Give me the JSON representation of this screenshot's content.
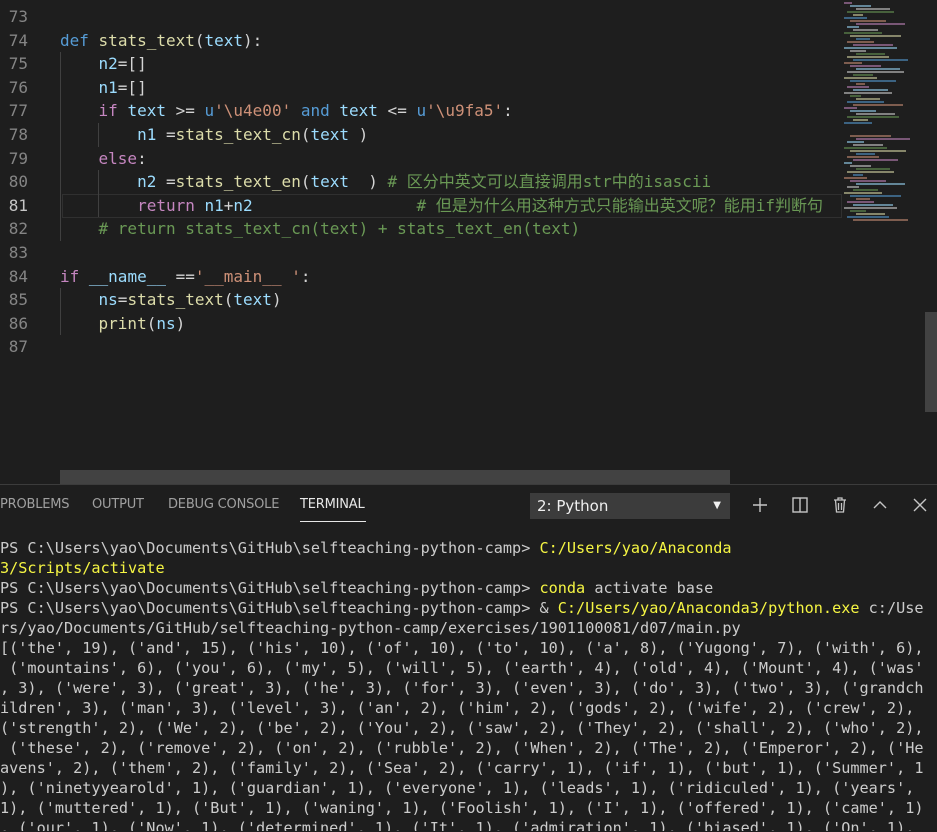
{
  "editor": {
    "lines": [
      {
        "num": "73",
        "tokens": []
      },
      {
        "num": "74",
        "tokens": [
          {
            "t": "def",
            "c": "kw"
          },
          {
            "t": " ",
            "c": "op"
          },
          {
            "t": "stats_text",
            "c": "fn"
          },
          {
            "t": "(",
            "c": "op"
          },
          {
            "t": "text",
            "c": "vr"
          },
          {
            "t": "):",
            "c": "op"
          }
        ]
      },
      {
        "num": "75",
        "tokens": [
          {
            "t": "    ",
            "c": "op"
          },
          {
            "t": "n2",
            "c": "vr"
          },
          {
            "t": "=[]",
            "c": "op"
          }
        ]
      },
      {
        "num": "76",
        "tokens": [
          {
            "t": "    ",
            "c": "op"
          },
          {
            "t": "n1",
            "c": "vr"
          },
          {
            "t": "=[]",
            "c": "op"
          }
        ]
      },
      {
        "num": "77",
        "tokens": [
          {
            "t": "    ",
            "c": "op"
          },
          {
            "t": "if",
            "c": "kw2"
          },
          {
            "t": " ",
            "c": "op"
          },
          {
            "t": "text",
            "c": "vr"
          },
          {
            "t": " >= ",
            "c": "op"
          },
          {
            "t": "u",
            "c": "kw"
          },
          {
            "t": "'\\u4e00'",
            "c": "str"
          },
          {
            "t": " ",
            "c": "op"
          },
          {
            "t": "and",
            "c": "kw"
          },
          {
            "t": " ",
            "c": "op"
          },
          {
            "t": "text",
            "c": "vr"
          },
          {
            "t": " <= ",
            "c": "op"
          },
          {
            "t": "u",
            "c": "kw"
          },
          {
            "t": "'\\u9fa5'",
            "c": "str"
          },
          {
            "t": ":",
            "c": "op"
          }
        ]
      },
      {
        "num": "78",
        "tokens": [
          {
            "t": "        ",
            "c": "op"
          },
          {
            "t": "n1",
            "c": "vr"
          },
          {
            "t": " =",
            "c": "op"
          },
          {
            "t": "stats_text_cn",
            "c": "fn"
          },
          {
            "t": "(",
            "c": "op"
          },
          {
            "t": "text",
            "c": "vr"
          },
          {
            "t": " )",
            "c": "op"
          }
        ]
      },
      {
        "num": "79",
        "tokens": [
          {
            "t": "    ",
            "c": "op"
          },
          {
            "t": "else",
            "c": "kw2"
          },
          {
            "t": ":",
            "c": "op"
          }
        ]
      },
      {
        "num": "80",
        "tokens": [
          {
            "t": "        ",
            "c": "op"
          },
          {
            "t": "n2",
            "c": "vr"
          },
          {
            "t": " =",
            "c": "op"
          },
          {
            "t": "stats_text_en",
            "c": "fn"
          },
          {
            "t": "(",
            "c": "op"
          },
          {
            "t": "text",
            "c": "vr"
          },
          {
            "t": "  ) ",
            "c": "op"
          },
          {
            "t": "# 区分中英文可以直接调用str中的isascii",
            "c": "cm"
          }
        ]
      },
      {
        "num": "81",
        "tokens": [
          {
            "t": "        ",
            "c": "op"
          },
          {
            "t": "return",
            "c": "kw2"
          },
          {
            "t": " ",
            "c": "op"
          },
          {
            "t": "n1",
            "c": "vr"
          },
          {
            "t": "+",
            "c": "op"
          },
          {
            "t": "n2",
            "c": "vr"
          },
          {
            "t": "                 ",
            "c": "op"
          },
          {
            "t": "# 但是为什么用这种方式只能输出英文呢？能用if判断句",
            "c": "cm"
          }
        ],
        "active": true
      },
      {
        "num": "82",
        "tokens": [
          {
            "t": "    ",
            "c": "op"
          },
          {
            "t": "# return stats_text_cn(text) + stats_text_en(text)",
            "c": "cm"
          }
        ]
      },
      {
        "num": "83",
        "tokens": []
      },
      {
        "num": "84",
        "tokens": [
          {
            "t": "if",
            "c": "kw2"
          },
          {
            "t": " ",
            "c": "op"
          },
          {
            "t": "__name__",
            "c": "vr"
          },
          {
            "t": " ==",
            "c": "op"
          },
          {
            "t": "'__main__ '",
            "c": "str"
          },
          {
            "t": ":",
            "c": "op"
          }
        ]
      },
      {
        "num": "85",
        "tokens": [
          {
            "t": "    ",
            "c": "op"
          },
          {
            "t": "ns",
            "c": "vr"
          },
          {
            "t": "=",
            "c": "op"
          },
          {
            "t": "stats_text",
            "c": "fn"
          },
          {
            "t": "(",
            "c": "op"
          },
          {
            "t": "text",
            "c": "vr"
          },
          {
            "t": ")",
            "c": "op"
          }
        ]
      },
      {
        "num": "86",
        "tokens": [
          {
            "t": "    ",
            "c": "op"
          },
          {
            "t": "print",
            "c": "fn"
          },
          {
            "t": "(",
            "c": "op"
          },
          {
            "t": "ns",
            "c": "vr"
          },
          {
            "t": ")",
            "c": "op"
          }
        ]
      },
      {
        "num": "87",
        "tokens": []
      }
    ]
  },
  "panel": {
    "tabs": [
      "PROBLEMS",
      "OUTPUT",
      "DEBUG CONSOLE",
      "TERMINAL"
    ],
    "active_tab": "TERMINAL",
    "terminal_select": "2: Python"
  },
  "terminal": {
    "lines": [
      [
        {
          "t": "PS C:\\Users\\yao\\Documents\\GitHub\\selfteaching-python-camp> ",
          "c": ""
        },
        {
          "t": "C:/Users/yao/Anaconda",
          "c": "y"
        }
      ],
      [
        {
          "t": "3/Scripts/activate",
          "c": "y"
        }
      ],
      [
        {
          "t": "PS C:\\Users\\yao\\Documents\\GitHub\\selfteaching-python-camp> ",
          "c": ""
        },
        {
          "t": "conda",
          "c": "y"
        },
        {
          "t": " activate base",
          "c": ""
        }
      ],
      [
        {
          "t": "PS C:\\Users\\yao\\Documents\\GitHub\\selfteaching-python-camp> & ",
          "c": ""
        },
        {
          "t": "C:/Users/yao/Anaconda3/python.exe",
          "c": "y"
        },
        {
          "t": " c:/Use",
          "c": ""
        }
      ],
      [
        {
          "t": "rs/yao/Documents/GitHub/selfteaching-python-camp/exercises/1901100081/d07/main.py",
          "c": ""
        }
      ],
      [
        {
          "t": "[('the', 19), ('and', 15), ('his', 10), ('of', 10), ('to', 10), ('a', 8), ('Yugong', 7), ('with', 6),",
          "c": ""
        }
      ],
      [
        {
          "t": " ('mountains', 6), ('you', 6), ('my', 5), ('will', 5), ('earth', 4), ('old', 4), ('Mount', 4), ('was'",
          "c": ""
        }
      ],
      [
        {
          "t": ", 3), ('were', 3), ('great', 3), ('he', 3), ('for', 3), ('even', 3), ('do', 3), ('two', 3), ('grandch",
          "c": ""
        }
      ],
      [
        {
          "t": "ildren', 3), ('man', 3), ('level', 3), ('an', 2), ('him', 2), ('gods', 2), ('wife', 2), ('crew', 2),",
          "c": ""
        }
      ],
      [
        {
          "t": "('strength', 2), ('We', 2), ('be', 2), ('You', 2), ('saw', 2), ('They', 2), ('shall', 2), ('who', 2),",
          "c": ""
        }
      ],
      [
        {
          "t": " ('these', 2), ('remove', 2), ('on', 2), ('rubble', 2), ('When', 2), ('The', 2), ('Emperor', 2), ('He",
          "c": ""
        }
      ],
      [
        {
          "t": "avens', 2), ('them', 2), ('family', 2), ('Sea', 2), ('carry', 1), ('if', 1), ('but', 1), ('Summer', 1",
          "c": ""
        }
      ],
      [
        {
          "t": "), ('ninetyyearold', 1), ('guardian', 1), ('everyone', 1), ('leads', 1), ('ridiculed', 1), ('years',",
          "c": ""
        }
      ],
      [
        {
          "t": "1), ('muttered', 1), ('But', 1), ('waning', 1), ('Foolish', 1), ('I', 1), ('offered', 1), ('came', 1)",
          "c": ""
        }
      ],
      [
        {
          "t": ", ('our', 1), ('Now', 1), ('determined', 1), ('It', 1), ('admiration', 1), ('biased', 1), ('On', 1),",
          "c": ""
        }
      ]
    ]
  }
}
